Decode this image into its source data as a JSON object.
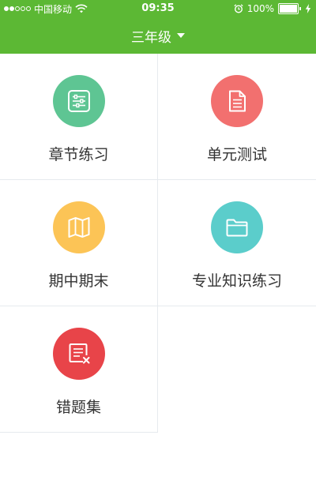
{
  "status_bar": {
    "carrier": "中国移动",
    "time": "09:35",
    "battery": "100%"
  },
  "header": {
    "title": "三年级"
  },
  "menu": {
    "items": [
      {
        "label": "章节练习",
        "icon": "sliders-list-icon",
        "color": "#5ec593"
      },
      {
        "label": "单元测试",
        "icon": "document-icon",
        "color": "#f2706f"
      },
      {
        "label": "期中期末",
        "icon": "map-icon",
        "color": "#fcc456"
      },
      {
        "label": "专业知识练习",
        "icon": "folder-icon",
        "color": "#5bcdcb"
      },
      {
        "label": "错题集",
        "icon": "wrong-questions-icon",
        "color": "#e84449"
      }
    ]
  },
  "colors": {
    "header_bg": "#5cb834",
    "divider": "#e6eaee",
    "label_text": "#333333"
  }
}
